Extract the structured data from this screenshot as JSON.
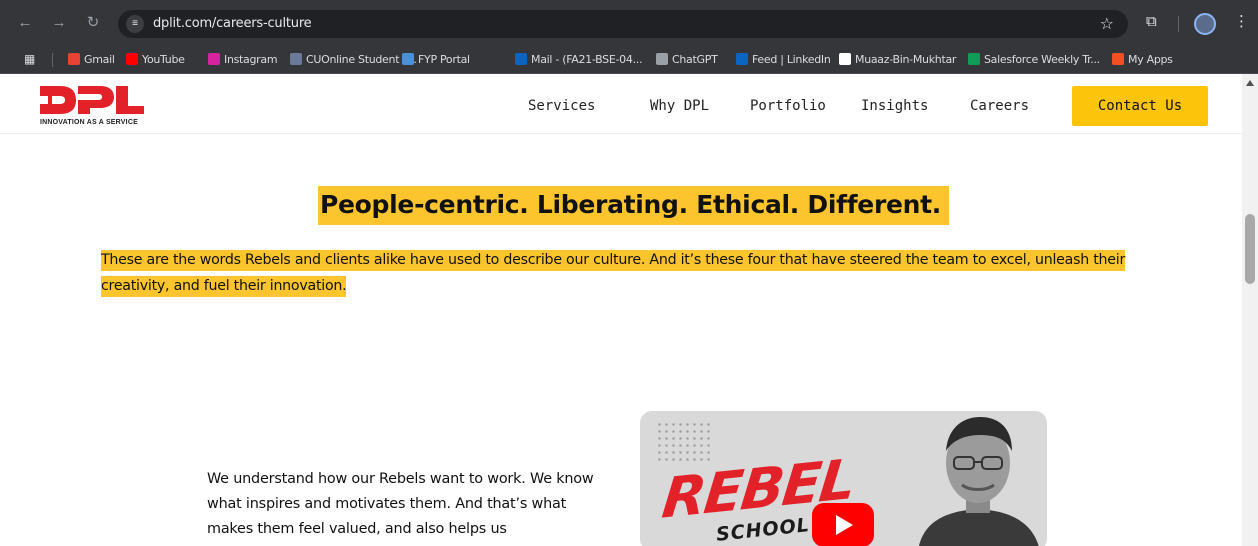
{
  "browser": {
    "url": "dplit.com/careers-culture",
    "bookmarks": [
      {
        "label": "Gmail",
        "icon": "gmail-icon",
        "color": "#ea4335"
      },
      {
        "label": "YouTube",
        "icon": "youtube-icon",
        "color": "#ff0000"
      },
      {
        "label": "Instagram",
        "icon": "instagram-icon",
        "color": "#d6249f"
      },
      {
        "label": "CUOnline Student P...",
        "icon": "cuonline-icon",
        "color": "#6b7a99"
      },
      {
        "label": "FYP Portal",
        "icon": "fyp-portal-icon",
        "color": "#4a90d9"
      },
      {
        "label": "Mail - (FA21-BSE-04...",
        "icon": "outlook-icon",
        "color": "#0a64c2"
      },
      {
        "label": "ChatGPT",
        "icon": "chatgpt-icon",
        "color": "#9aa0a6"
      },
      {
        "label": "Feed | LinkedIn",
        "icon": "linkedin-icon",
        "color": "#0a66c2"
      },
      {
        "label": "Muaaz-Bin-Mukhtar",
        "icon": "github-icon",
        "color": "#ffffff"
      },
      {
        "label": "Salesforce Weekly Tr...",
        "icon": "sheets-icon",
        "color": "#0f9d58"
      },
      {
        "label": "My Apps",
        "icon": "microsoft-icon",
        "color": "#f25022"
      }
    ]
  },
  "header": {
    "logo_text": "DPL",
    "logo_tagline": "INNOVATION AS A SERVICE",
    "nav": [
      "Services",
      "Why DPL",
      "Portfolio",
      "Insights",
      "Careers"
    ],
    "contact_label": "Contact Us",
    "accent_color": "#fcc40a",
    "brand_color": "#e32128"
  },
  "content": {
    "headline": "People-centric. Liberating. Ethical. Different.",
    "intro": "These are the words Rebels and clients alike have used to describe our culture. And it’s these four that have steered the team to excel, unleash their creativity, and fuel their innovation.",
    "body": "We understand how our Rebels want to work. We know what inspires and motivates them. And that’s what makes them feel valued, and also helps us",
    "video": {
      "title_line1": "REBEL",
      "title_line2": "SCHOOL"
    }
  }
}
